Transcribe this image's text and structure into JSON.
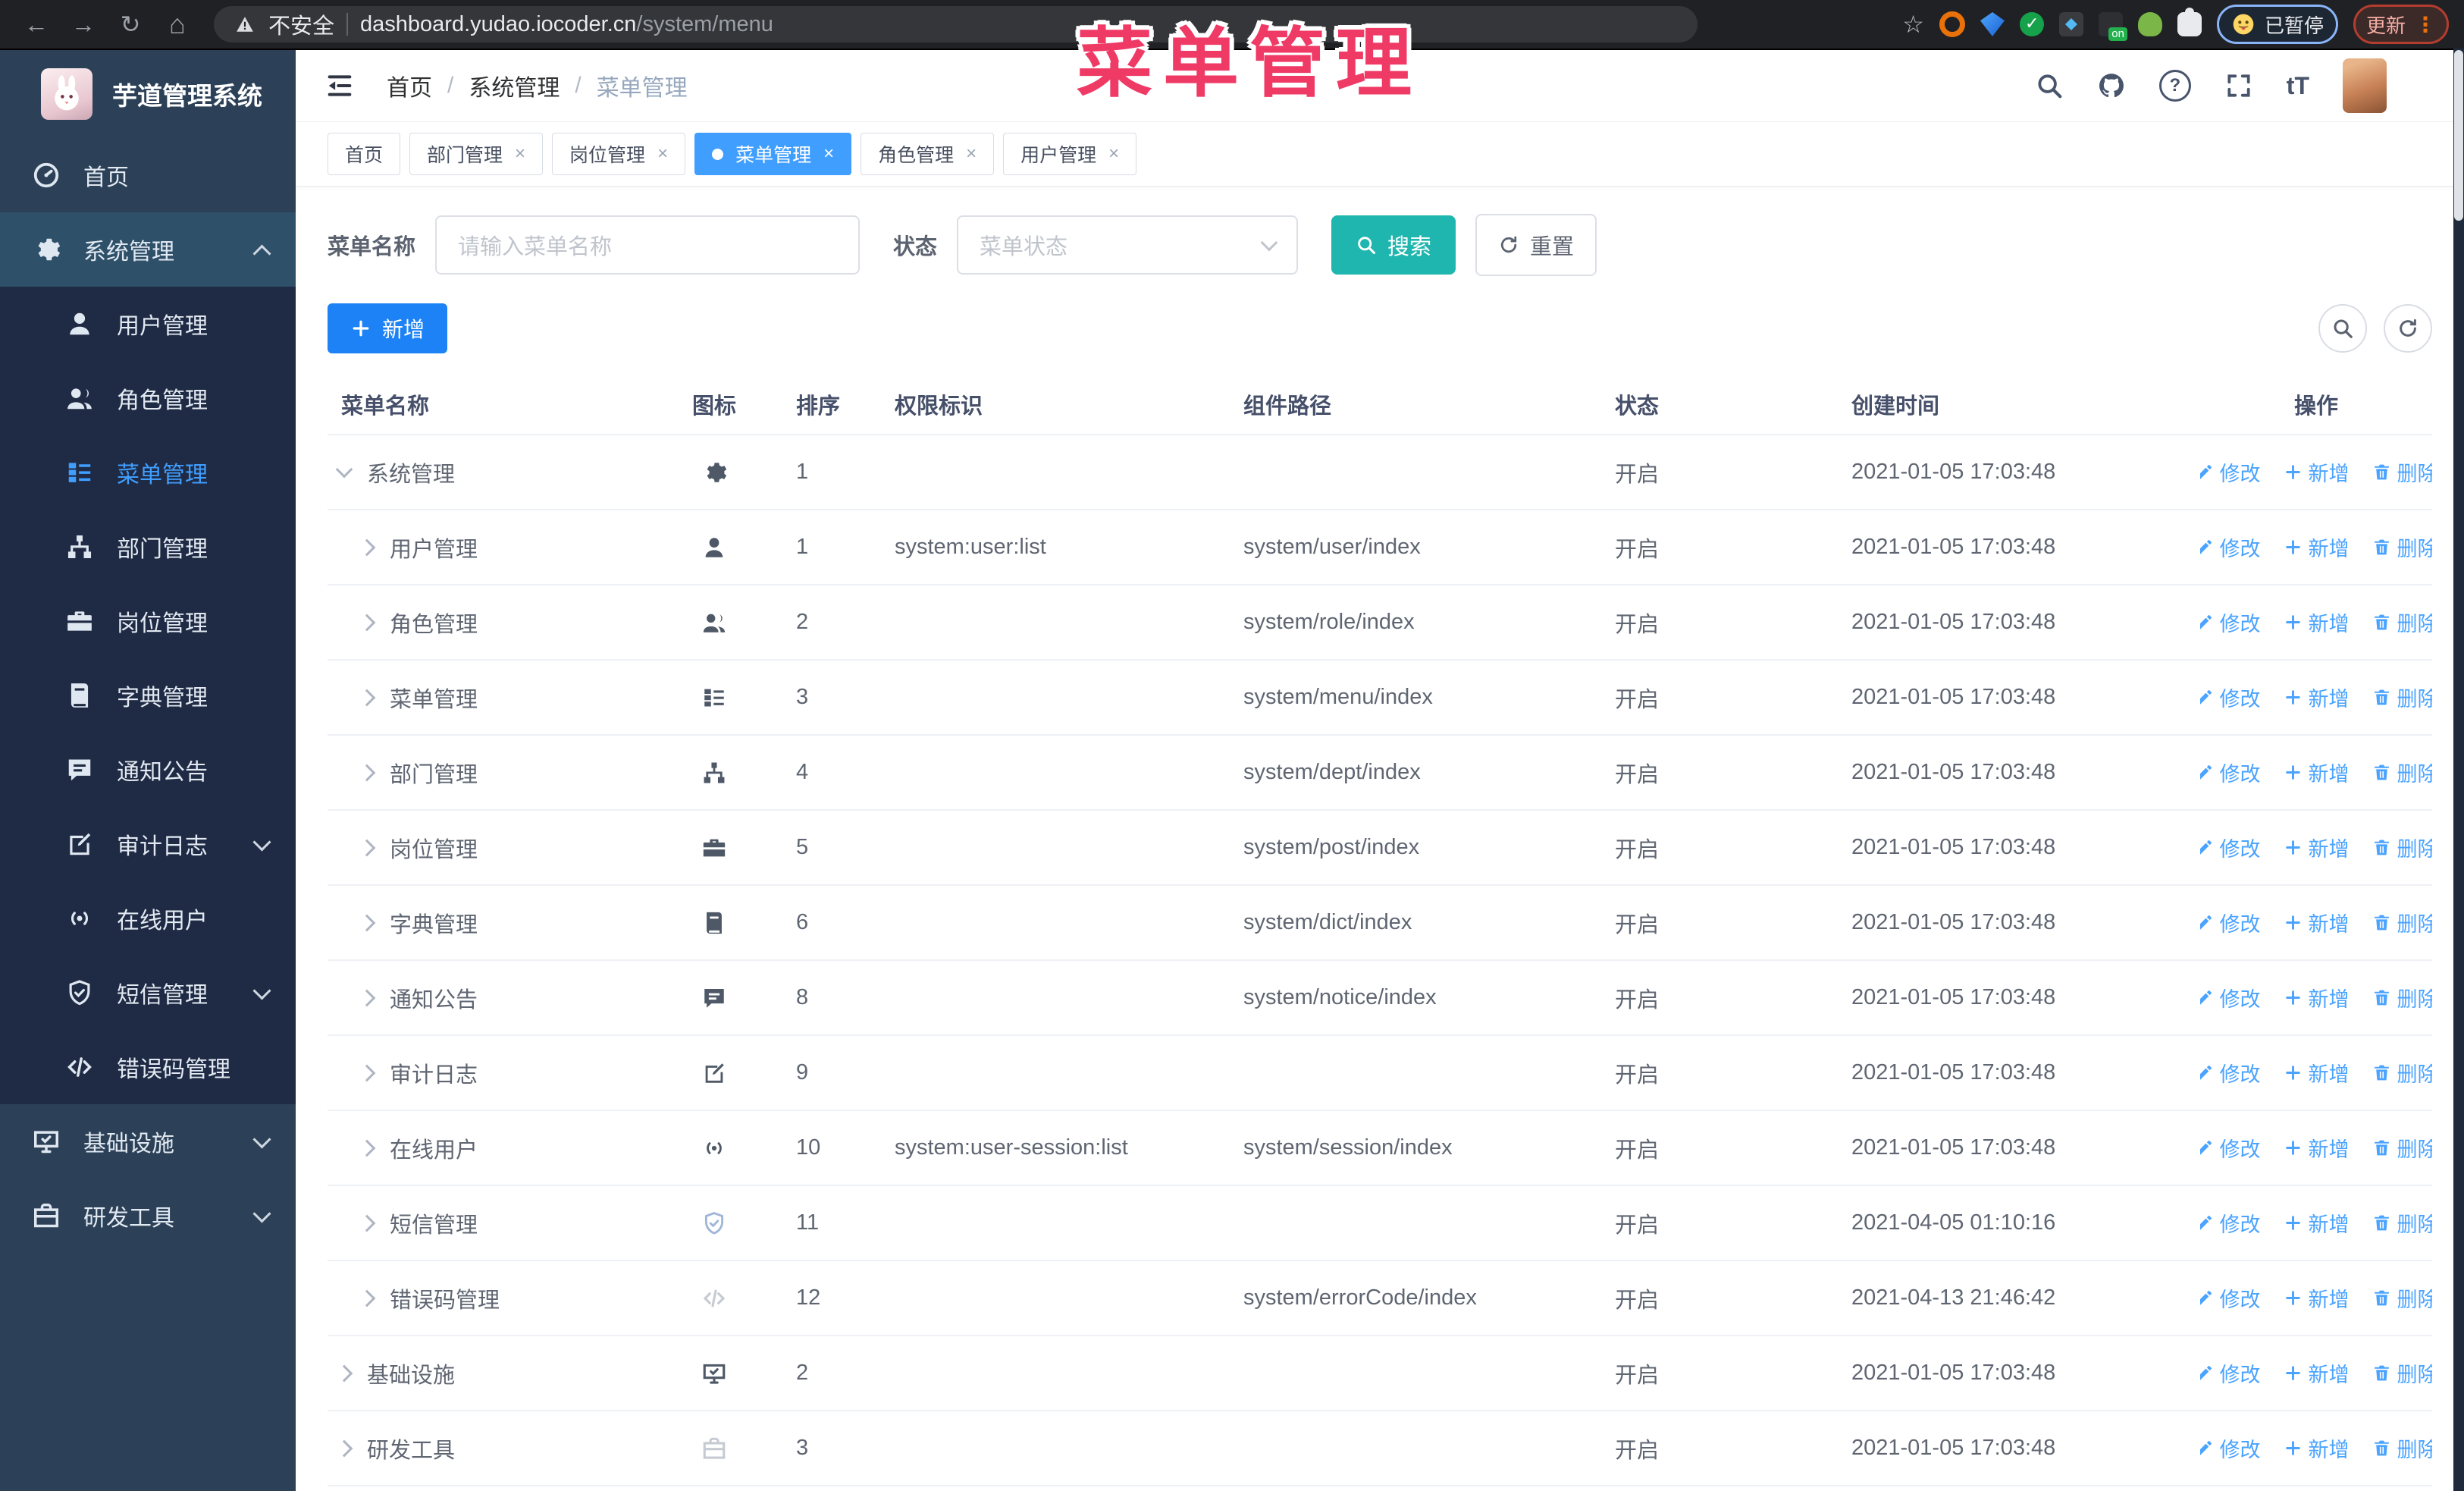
{
  "overlay": {
    "title": "菜单管理"
  },
  "browser": {
    "secure_label": "不安全",
    "url_host": "dashboard.yudao.iocoder.cn",
    "url_path": "/system/menu",
    "paused_badge": "已暂停",
    "update_button": "更新",
    "ext_on_badge": "on"
  },
  "app": {
    "title": "芋道管理系统"
  },
  "header": {
    "breadcrumb": [
      {
        "label": "首页"
      },
      {
        "label": "系统管理"
      },
      {
        "label": "菜单管理"
      }
    ]
  },
  "tabs": [
    {
      "label": "首页",
      "closable": false
    },
    {
      "label": "部门管理",
      "closable": true
    },
    {
      "label": "岗位管理",
      "closable": true
    },
    {
      "label": "菜单管理",
      "closable": true,
      "active": true
    },
    {
      "label": "角色管理",
      "closable": true
    },
    {
      "label": "用户管理",
      "closable": true
    }
  ],
  "sidebar": {
    "top": [
      {
        "label": "首页",
        "icon": "dashboard-icon"
      },
      {
        "label": "系统管理",
        "icon": "gear-icon",
        "expanded": true
      }
    ],
    "sub": [
      {
        "label": "用户管理",
        "icon": "user-icon"
      },
      {
        "label": "角色管理",
        "icon": "users-icon"
      },
      {
        "label": "菜单管理",
        "icon": "menu-tree-icon",
        "active": true
      },
      {
        "label": "部门管理",
        "icon": "org-tree-icon"
      },
      {
        "label": "岗位管理",
        "icon": "briefcase-icon"
      },
      {
        "label": "字典管理",
        "icon": "book-icon"
      },
      {
        "label": "通知公告",
        "icon": "message-icon"
      },
      {
        "label": "审计日志",
        "icon": "edit-square-icon",
        "arrow": "down"
      },
      {
        "label": "在线用户",
        "icon": "online-icon"
      },
      {
        "label": "短信管理",
        "icon": "shield-check-icon",
        "arrow": "down"
      },
      {
        "label": "错误码管理",
        "icon": "code-icon"
      }
    ],
    "bottom": [
      {
        "label": "基础设施",
        "icon": "monitor-icon",
        "arrow": "down"
      },
      {
        "label": "研发工具",
        "icon": "toolbox-icon",
        "arrow": "down"
      }
    ]
  },
  "search": {
    "name_label": "菜单名称",
    "name_placeholder": "请输入菜单名称",
    "status_label": "状态",
    "status_placeholder": "菜单状态",
    "search_button": "搜索",
    "reset_button": "重置"
  },
  "toolbar": {
    "add_button": "新增"
  },
  "table": {
    "headers": [
      "菜单名称",
      "图标",
      "排序",
      "权限标识",
      "组件路径",
      "状态",
      "创建时间",
      "操作"
    ],
    "actions": {
      "edit": "修改",
      "add": "新增",
      "delete": "删除"
    },
    "rows": [
      {
        "name": "系统管理",
        "icon": "gear-icon",
        "sort": "1",
        "perm": "",
        "path": "",
        "status": "开启",
        "created": "2021-01-05 17:03:48"
      },
      {
        "name": "用户管理",
        "icon": "user-icon",
        "sort": "1",
        "perm": "system:user:list",
        "path": "system/user/index",
        "status": "开启",
        "created": "2021-01-05 17:03:48"
      },
      {
        "name": "角色管理",
        "icon": "users-icon",
        "sort": "2",
        "perm": "",
        "path": "system/role/index",
        "status": "开启",
        "created": "2021-01-05 17:03:48"
      },
      {
        "name": "菜单管理",
        "icon": "menu-tree-icon",
        "sort": "3",
        "perm": "",
        "path": "system/menu/index",
        "status": "开启",
        "created": "2021-01-05 17:03:48"
      },
      {
        "name": "部门管理",
        "icon": "org-tree-icon",
        "sort": "4",
        "perm": "",
        "path": "system/dept/index",
        "status": "开启",
        "created": "2021-01-05 17:03:48"
      },
      {
        "name": "岗位管理",
        "icon": "briefcase-icon",
        "sort": "5",
        "perm": "",
        "path": "system/post/index",
        "status": "开启",
        "created": "2021-01-05 17:03:48"
      },
      {
        "name": "字典管理",
        "icon": "book-icon",
        "sort": "6",
        "perm": "",
        "path": "system/dict/index",
        "status": "开启",
        "created": "2021-01-05 17:03:48"
      },
      {
        "name": "通知公告",
        "icon": "message-icon",
        "sort": "8",
        "perm": "",
        "path": "system/notice/index",
        "status": "开启",
        "created": "2021-01-05 17:03:48"
      },
      {
        "name": "审计日志",
        "icon": "edit-square-icon",
        "sort": "9",
        "perm": "",
        "path": "",
        "status": "开启",
        "created": "2021-01-05 17:03:48"
      },
      {
        "name": "在线用户",
        "icon": "online-icon",
        "sort": "10",
        "perm": "system:user-session:list",
        "path": "system/session/index",
        "status": "开启",
        "created": "2021-01-05 17:03:48"
      },
      {
        "name": "短信管理",
        "icon": "shield-check-icon",
        "sort": "11",
        "perm": "",
        "path": "",
        "status": "开启",
        "created": "2021-04-05 01:10:16"
      },
      {
        "name": "错误码管理",
        "icon": "code-icon",
        "sort": "12",
        "perm": "",
        "path": "system/errorCode/index",
        "status": "开启",
        "created": "2021-04-13 21:46:42"
      },
      {
        "name": "基础设施",
        "icon": "monitor-icon",
        "sort": "2",
        "perm": "",
        "path": "",
        "status": "开启",
        "created": "2021-01-05 17:03:48"
      },
      {
        "name": "研发工具",
        "icon": "toolbox-icon",
        "sort": "3",
        "perm": "",
        "path": "",
        "status": "开启",
        "created": "2021-01-05 17:03:48"
      }
    ]
  }
}
